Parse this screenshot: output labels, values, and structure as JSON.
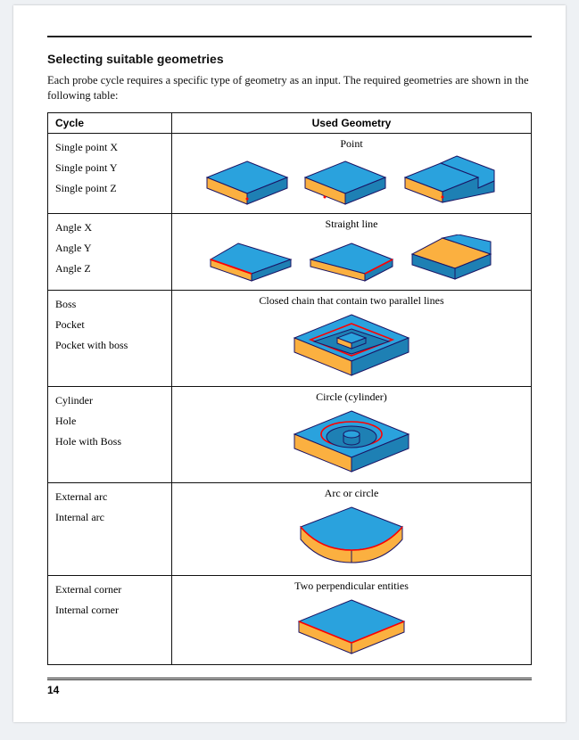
{
  "heading": "Selecting suitable geometries",
  "intro": "Each probe cycle requires a specific type of geometry as an input. The required geometries are shown in the following table:",
  "columns": {
    "cycle": "Cycle",
    "used": "Used Geometry"
  },
  "rows": [
    {
      "cycles": [
        "Single point X",
        "Single point Y",
        "Single point Z"
      ],
      "geo": "Point"
    },
    {
      "cycles": [
        "Angle X",
        "Angle Y",
        "Angle Z"
      ],
      "geo": "Straight line"
    },
    {
      "cycles": [
        "Boss",
        "Pocket",
        "Pocket with boss"
      ],
      "geo": "Closed chain that contain two parallel lines"
    },
    {
      "cycles": [
        "Cylinder",
        "Hole",
        "Hole with Boss"
      ],
      "geo": "Circle (cylinder)"
    },
    {
      "cycles": [
        "External arc",
        "Internal arc"
      ],
      "geo": "Arc or circle"
    },
    {
      "cycles": [
        "External corner",
        "Internal corner"
      ],
      "geo": "Two perpendicular entities"
    }
  ],
  "page_number": "14",
  "colors": {
    "top": "#2aa2dd",
    "side": "#fbb040",
    "stroke": "#1b1464",
    "hi": "#ff0000"
  }
}
